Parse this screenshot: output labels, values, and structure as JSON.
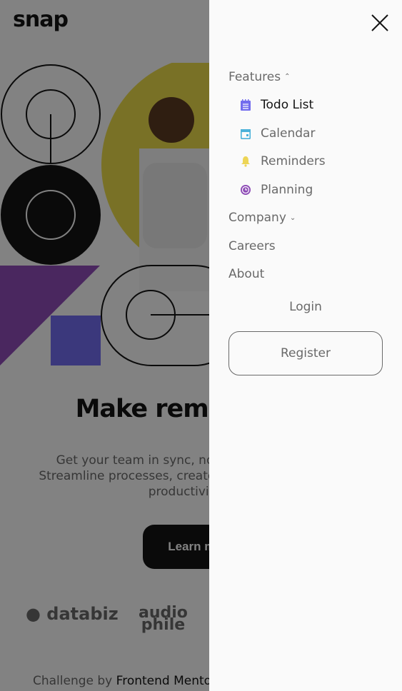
{
  "logo": "snap",
  "hero": {
    "headline": "Make remote work",
    "subtext": "Get your team in sync, no matter your location. Streamline processes, create team rituals, and watch productivity soar.",
    "cta": "Learn more"
  },
  "clients": [
    "databiz",
    "audio",
    "phile"
  ],
  "attribution": {
    "prefix": "Challenge by",
    "link": "Frontend Mentor"
  },
  "drawer": {
    "features": "Features",
    "feature_items": [
      {
        "label": "Todo List",
        "icon": "todo-icon",
        "color": "#726CEE"
      },
      {
        "label": "Calendar",
        "icon": "calendar-icon",
        "color": "#4BB1DA"
      },
      {
        "label": "Reminders",
        "icon": "bell-icon",
        "color": "#EDD556"
      },
      {
        "label": "Planning",
        "icon": "clock-icon",
        "color": "#8E4CB6"
      }
    ],
    "company": "Company",
    "careers": "Careers",
    "about": "About",
    "login": "Login",
    "register": "Register"
  }
}
